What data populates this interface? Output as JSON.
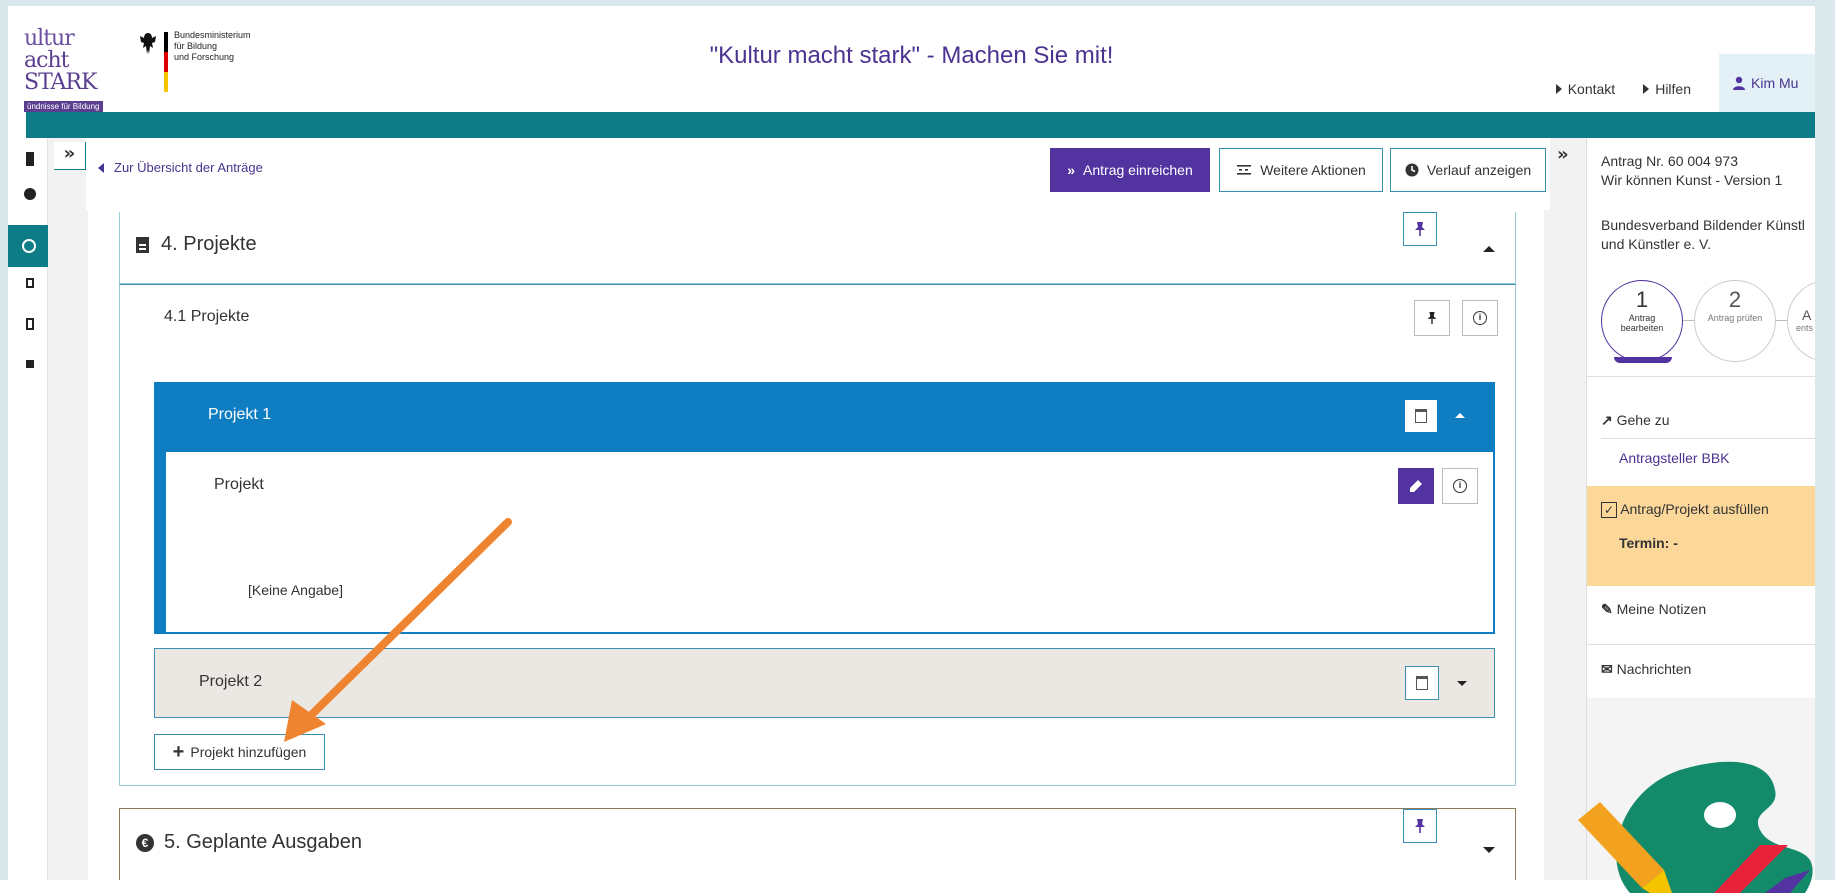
{
  "header": {
    "app_title": "\"Kultur macht stark\" - Machen Sie mit!",
    "logo": {
      "line1": "ultur",
      "line2": "acht STARK",
      "line3": "ündnisse für Bildung"
    },
    "ministry": {
      "line1": "Bundesministerium",
      "line2": "für Bildung",
      "line3": "und Forschung"
    },
    "links": [
      {
        "label": "Kontakt"
      },
      {
        "label": "Hilfen"
      }
    ],
    "user": "Kim Mu"
  },
  "toolbar": {
    "toggle_left": "»",
    "back_link": "Zur Übersicht der Anträge",
    "submit_label": "Antrag einreichen",
    "more_actions_label": "Weitere Aktionen",
    "history_label": "Verlauf anzeigen",
    "toggle_right": "»"
  },
  "sections": {
    "s4": {
      "title": "4. Projekte"
    },
    "s4_1": {
      "title": "4.1 Projekte"
    },
    "project1": {
      "title": "Projekt 1",
      "field_label": "Projekt",
      "field_value": "[Keine Angabe]"
    },
    "project2": {
      "title": "Projekt 2"
    },
    "add_project": "Projekt hinzufügen",
    "s5": {
      "title": "5. Geplante Ausgaben"
    }
  },
  "right_panel": {
    "application_no": "Antrag Nr. 60 004 973",
    "version": "Wir können Kunst - Version 1",
    "org_line1": "Bundesverband Bildender Künstl",
    "org_line2": "und Künstler e. V.",
    "steps": [
      {
        "num": "1",
        "label1": "Antrag",
        "label2": "bearbeiten",
        "active": true
      },
      {
        "num": "2",
        "label1": "Antrag prüfen",
        "label2": "",
        "active": false
      },
      {
        "num": "A",
        "label1": "ents",
        "label2": "",
        "active": false
      }
    ],
    "goto_label": "Gehe zu",
    "goto_link": "Antragsteller BBK",
    "task_label": "Antrag/Projekt ausfüllen",
    "deadline": "Termin: -",
    "notes_label": "Meine Notizen",
    "messages_label": "Nachrichten"
  },
  "colors": {
    "teal": "#0e7c86",
    "purple": "#5333a0",
    "blue": "#0f7dc2",
    "orange_arrow": "#ef8430",
    "highlight": "#fbd89a"
  },
  "icons": [
    "flag-icon",
    "pin-icon",
    "info-icon",
    "trash-icon",
    "edit-icon",
    "user-icon",
    "document-icon",
    "euro-icon",
    "arrow-icon",
    "envelope-icon",
    "palette-icon"
  ]
}
